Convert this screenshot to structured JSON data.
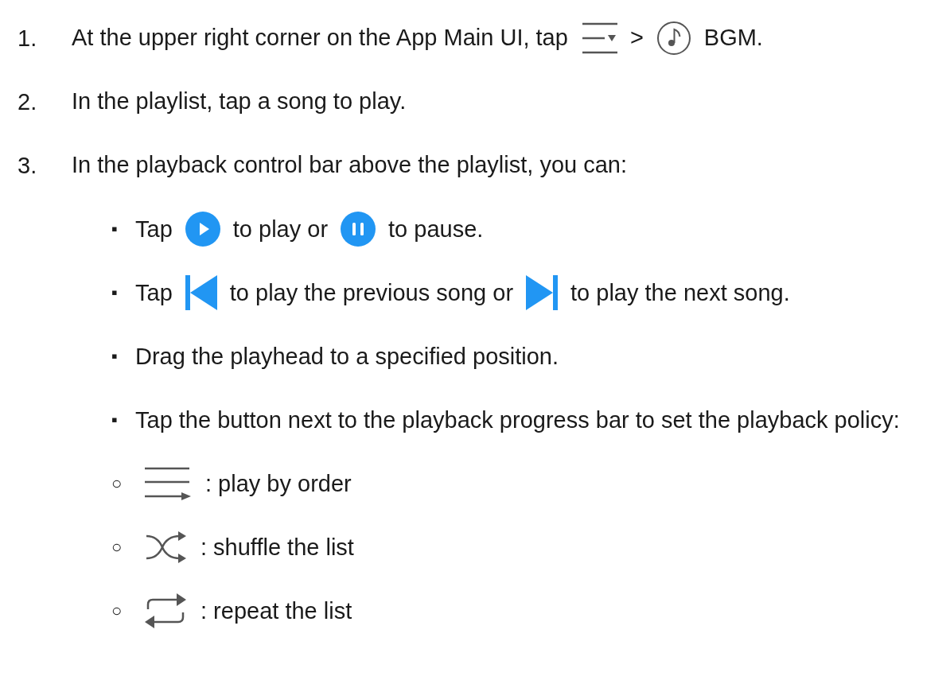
{
  "steps": [
    {
      "number": "1.",
      "parts": [
        {
          "kind": "text",
          "text": "At the upper right corner on the App Main UI, tap"
        },
        {
          "kind": "menu"
        },
        {
          "kind": "text",
          "text": ">"
        },
        {
          "kind": "music"
        },
        {
          "kind": "text",
          "text": "BGM."
        }
      ]
    },
    {
      "number": "2.",
      "parts": [
        {
          "kind": "text",
          "text": "In the playlist, tap a song to play."
        }
      ]
    },
    {
      "number": "3.",
      "parts": [
        {
          "kind": "text",
          "text": "In the playback control bar above the playlist, you can:"
        }
      ],
      "children": [
        {
          "marker": "▪",
          "parts": [
            {
              "kind": "text",
              "text": "Tap"
            },
            {
              "kind": "play"
            },
            {
              "kind": "text",
              "text": "to play or"
            },
            {
              "kind": "pause"
            },
            {
              "kind": "text",
              "text": "to pause."
            }
          ]
        },
        {
          "marker": "▪",
          "parts": [
            {
              "kind": "text",
              "text": "Tap"
            },
            {
              "kind": "previous"
            },
            {
              "kind": "text",
              "text": "to play the previous song or"
            },
            {
              "kind": "next"
            },
            {
              "kind": "text",
              "text": "to play the next song."
            }
          ]
        },
        {
          "marker": "▪",
          "parts": [
            {
              "kind": "text",
              "text": "Drag the playhead to a specified position."
            }
          ]
        },
        {
          "marker": "▪",
          "parts": [
            {
              "kind": "text",
              "text": "Tap the button next to the playback progress bar to set the playback policy:"
            }
          ],
          "children": [
            {
              "marker": "○",
              "parts": [
                {
                  "kind": "order"
                },
                {
                  "kind": "text",
                  "text": ": play by order"
                }
              ]
            },
            {
              "marker": "○",
              "parts": [
                {
                  "kind": "shuffle"
                },
                {
                  "kind": "text",
                  "text": ": shuffle the list"
                }
              ]
            },
            {
              "marker": "○",
              "parts": [
                {
                  "kind": "repeat"
                },
                {
                  "kind": "text",
                  "text": ": repeat the list"
                }
              ]
            }
          ]
        }
      ]
    }
  ]
}
